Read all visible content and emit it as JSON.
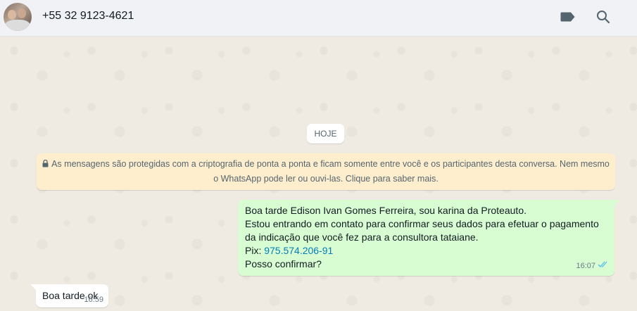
{
  "header": {
    "contact_name": "+55 32 9123-4621",
    "icons": [
      "label-icon",
      "search-icon"
    ]
  },
  "chat": {
    "date_chip": "HOJE",
    "encryption_notice": {
      "line1": "As mensagens são protegidas com a criptografia de ponta a ponta e ficam somente entre você e os participantes desta conversa. Nem mesmo",
      "line2": "o WhatsApp pode ler ou ouvi-las. Clique para saber mais."
    },
    "messages": [
      {
        "direction": "outgoing",
        "lines": [
          "Boa tarde   Edison Ivan Gomes Ferreira, sou karina da Proteauto.",
          "Estou entrando em contato para confirmar seus dados para efetuar o pagamento",
          "da indicação que você fez para a consultora tataiane."
        ],
        "pix_label": "Pix: ",
        "pix_value": "975.574.206-91",
        "last_line": "Posso confirmar?",
        "time": "16:07",
        "status": "read"
      },
      {
        "direction": "incoming",
        "text": "Boa tarde ok",
        "time": "16:59"
      }
    ]
  },
  "colors": {
    "header_bg": "#f0f2f5",
    "chat_bg": "#efeae2",
    "outgoing_bubble": "#d9fdd3",
    "incoming_bubble": "#ffffff",
    "notice_bg": "#ffeecd",
    "read_ticks": "#53bdeb",
    "link": "#027eb5"
  }
}
